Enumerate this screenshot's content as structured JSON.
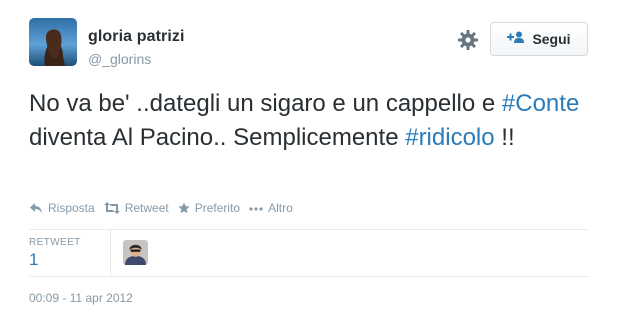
{
  "user": {
    "fullname": "gloria patrizi",
    "screenname": "@_glorins"
  },
  "follow_button": {
    "label": "Segui"
  },
  "tweet": {
    "segments": [
      {
        "text": "No va be' ..dategli un sigaro e un cappello e ",
        "type": "text"
      },
      {
        "text": "#Conte",
        "type": "hashtag"
      },
      {
        "text": " diventa Al Pacino.. Semplicemente ",
        "type": "text"
      },
      {
        "text": "#ridicolo",
        "type": "hashtag"
      },
      {
        "text": " !!",
        "type": "text"
      }
    ]
  },
  "actions": [
    {
      "label": "Risposta",
      "icon": "reply-icon"
    },
    {
      "label": "Retweet",
      "icon": "retweet-icon"
    },
    {
      "label": "Preferito",
      "icon": "star-icon"
    },
    {
      "label": "Altro",
      "icon": "more-icon"
    }
  ],
  "stats": {
    "retweet_label": "RETWEET",
    "retweet_count": "1"
  },
  "timestamp": "00:09 - 11 apr 2012",
  "colors": {
    "link": "#2b7bb9",
    "muted": "#8899a6",
    "text": "#292f33"
  }
}
